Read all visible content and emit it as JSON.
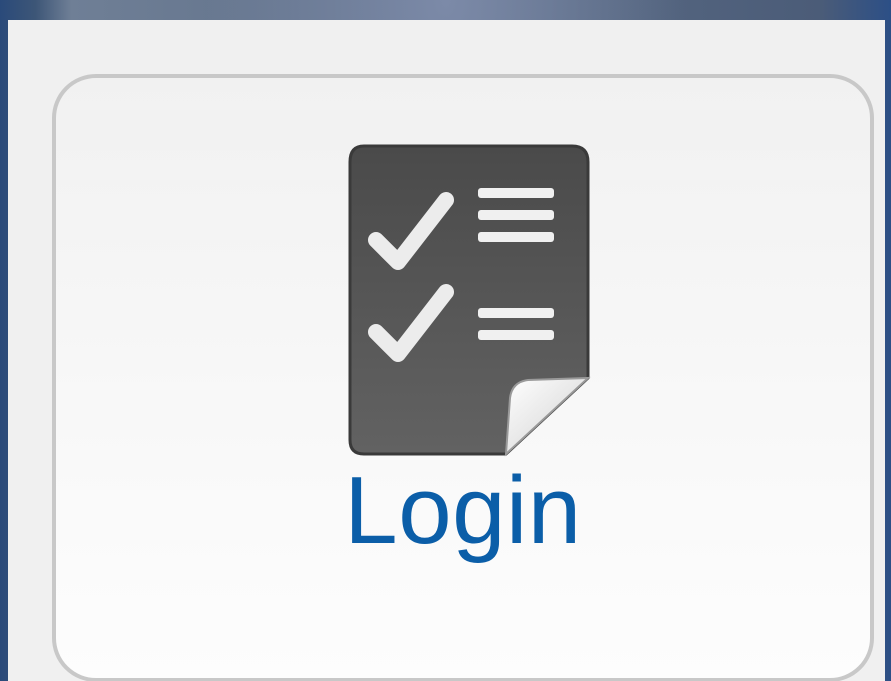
{
  "tile": {
    "label": "Login",
    "icon": "checklist-document-icon"
  },
  "colors": {
    "label": "#0b5ea8",
    "card_border": "#c8c8c8",
    "card_bg": "#f4f4f4",
    "icon_body": "#5a5a5a"
  }
}
